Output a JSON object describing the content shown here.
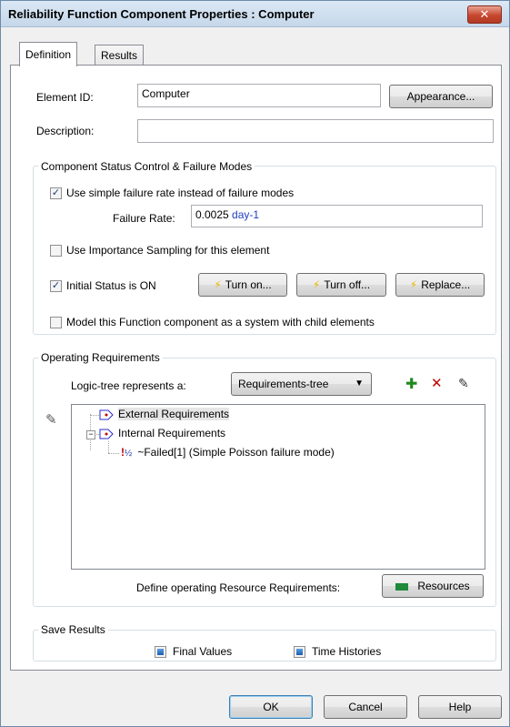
{
  "window": {
    "title": "Reliability Function Component Properties : Computer",
    "close_glyph": "✕"
  },
  "tabs": [
    {
      "label": "Definition"
    },
    {
      "label": "Results"
    }
  ],
  "element_id": {
    "label": "Element ID:",
    "value": "Computer",
    "appearance_button": "Appearance..."
  },
  "description": {
    "label": "Description:",
    "value": ""
  },
  "status_group": {
    "title": "Component Status Control & Failure Modes",
    "simple_rate": {
      "label": "Use simple failure rate instead of failure modes",
      "checked": true
    },
    "failure_rate": {
      "label": "Failure Rate:",
      "value": "0.0025",
      "unit": "day-1"
    },
    "importance": {
      "label": "Use Importance Sampling for this element",
      "checked": false
    },
    "initial_status": {
      "label": "Initial Status is ON",
      "checked": true
    },
    "turn_on": "Turn on...",
    "turn_off": "Turn off...",
    "replace": "Replace...",
    "model_system": {
      "label": "Model this Function component as a system with child elements",
      "checked": false
    }
  },
  "op_group": {
    "title": "Operating Requirements",
    "logic_label": "Logic-tree represents a:",
    "logic_value": "Requirements-tree",
    "tree": [
      {
        "label": "External Requirements"
      },
      {
        "label": "Internal Requirements"
      },
      {
        "label": "~Failed[1]  (Simple Poisson failure mode)"
      }
    ],
    "resources_label": "Define operating Resource Requirements:",
    "resources_button": "Resources"
  },
  "save_group": {
    "title": "Save Results",
    "final_values": {
      "label": "Final Values",
      "checked": true
    },
    "time_histories": {
      "label": "Time Histories",
      "checked": true
    }
  },
  "footer": {
    "ok": "OK",
    "cancel": "Cancel",
    "help": "Help"
  }
}
